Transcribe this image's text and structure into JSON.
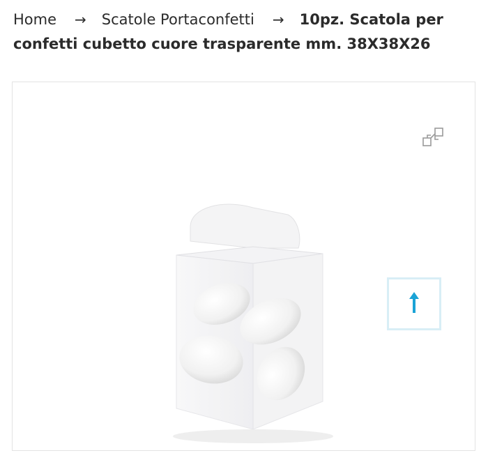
{
  "breadcrumb": {
    "home": "Home",
    "separator": "→",
    "category": "Scatole Portaconfetti",
    "current": "10pz. Scatola per confetti cubetto cuore trasparente mm. 38X38X26"
  },
  "gallery": {
    "zoom_icon": "expand-icon",
    "image_alt": "Scatola per confetti cubetto cuore trasparente",
    "scroll_top_icon": "arrow-up-icon"
  },
  "colors": {
    "text": "#2b2b2b",
    "accent": "#1ba3d6",
    "border": "#e3e3e3"
  }
}
